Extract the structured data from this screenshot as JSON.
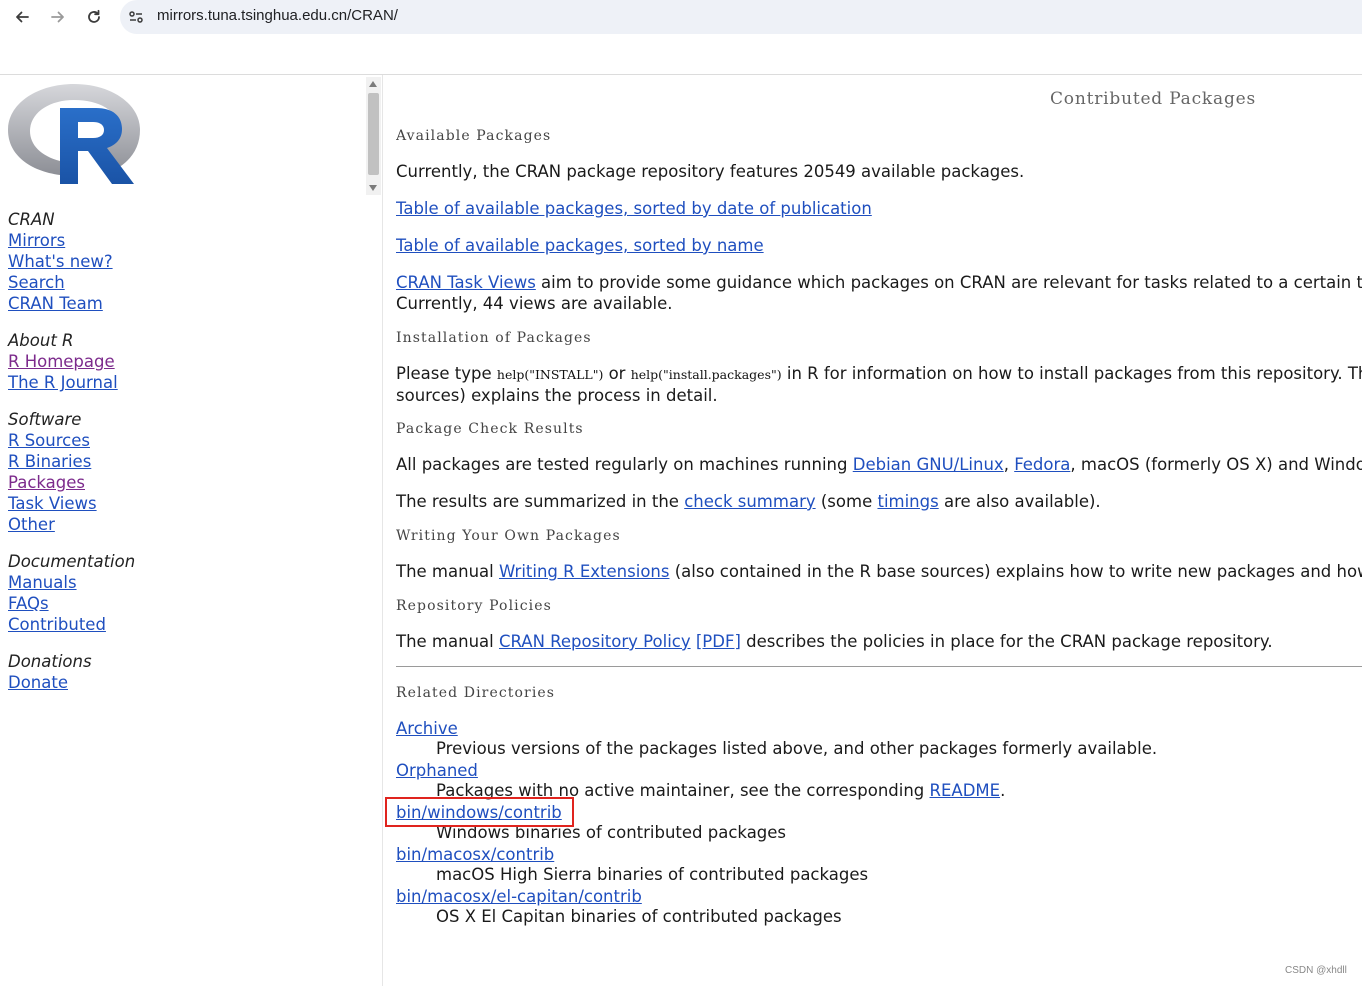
{
  "browser": {
    "url": "mirrors.tuna.tsinghua.edu.cn/CRAN/"
  },
  "sidebar": {
    "groups": [
      {
        "heading": "CRAN",
        "links": [
          "Mirrors",
          "What's new?",
          "Search",
          "CRAN Team"
        ]
      },
      {
        "heading": "About R",
        "links": [
          "R Homepage",
          "The R Journal"
        ]
      },
      {
        "heading": "Software",
        "links": [
          "R Sources",
          "R Binaries",
          "Packages",
          "Task Views",
          "Other"
        ]
      },
      {
        "heading": "Documentation",
        "links": [
          "Manuals",
          "FAQs",
          "Contributed"
        ]
      },
      {
        "heading": "Donations",
        "links": [
          "Donate"
        ]
      }
    ]
  },
  "main": {
    "title": "Contributed Packages",
    "available": {
      "heading": "Available Packages",
      "count_text": "Currently, the CRAN package repository features 20549 available packages.",
      "link_by_date": "Table of available packages, sorted by date of publication",
      "link_by_name": "Table of available packages, sorted by name",
      "taskviews_link": "CRAN Task Views",
      "taskviews_text": " aim to provide some guidance which packages on CRAN are relevant for tasks related to a certain topic. They",
      "views_count": "Currently, 44 views are available."
    },
    "installation": {
      "heading": "Installation of Packages",
      "t1": "Please type ",
      "code1": "help(\"INSTALL\")",
      "t2": " or ",
      "code2": "help(\"install.packages\")",
      "t3": " in R for information on how to install packages from this repository. The m",
      "line2": "sources) explains the process in detail."
    },
    "check": {
      "heading": "Package Check Results",
      "t1": "All packages are tested regularly on machines running ",
      "debian": "Debian GNU/Linux",
      "comma": ", ",
      "fedora": "Fedora",
      "t2": ", macOS (formerly OS X) and Windows.",
      "r1": "The results are summarized in the ",
      "summary_link": "check summary",
      "r2": " (some ",
      "timings_link": "timings",
      "r3": " are also available)."
    },
    "writing": {
      "heading": "Writing Your Own Packages",
      "t1": "The manual ",
      "link": "Writing R Extensions",
      "t2": " (also contained in the R base sources) explains how to write new packages and how to contri"
    },
    "policies": {
      "heading": "Repository Policies",
      "t1": "The manual ",
      "link": "CRAN Repository Policy",
      "pdf": "[PDF]",
      "t2": " describes the policies in place for the CRAN package repository."
    },
    "related": {
      "heading": "Related Directories",
      "archive": "Archive",
      "archive_desc": "Previous versions of the packages listed above, and other packages formerly available.",
      "orphaned": "Orphaned",
      "orphaned_desc": "Packages with no active maintainer, see the corresponding ",
      "readme": "README",
      "period": ".",
      "win": "bin/windows/contrib",
      "win_desc": "Windows binaries of contributed packages",
      "mac": "bin/macosx/contrib",
      "mac_desc": "macOS High Sierra binaries of contributed packages",
      "elcap": "bin/macosx/el-capitan/contrib",
      "elcap_desc": "OS X El Capitan binaries of contributed packages"
    }
  },
  "watermark": "CSDN @xhdll",
  "colors": {
    "link": "#1f4fbf",
    "visited": "#7c2a8c",
    "highlight": "#e0241e"
  }
}
